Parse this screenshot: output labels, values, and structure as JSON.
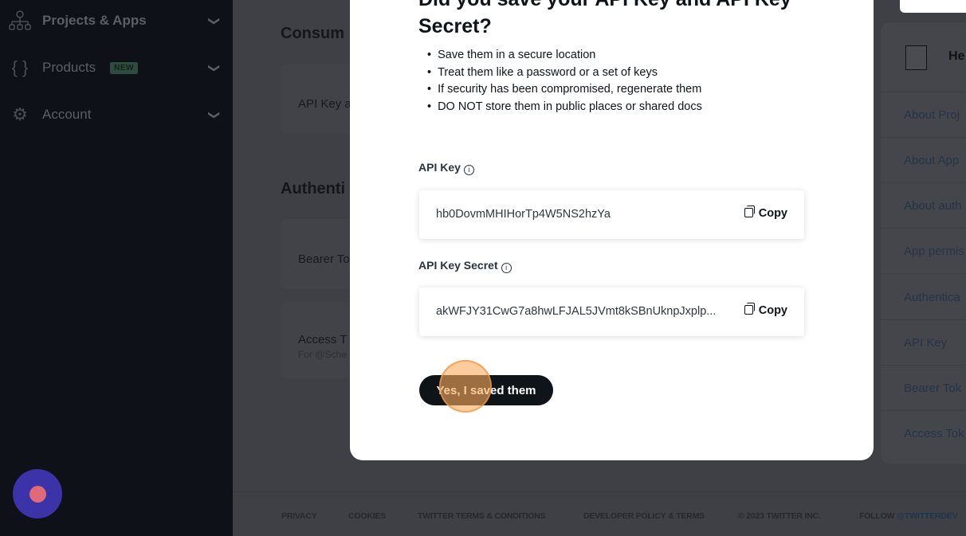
{
  "sidebar": {
    "items": [
      {
        "label": "Projects & Apps",
        "icon": "sitemap-icon"
      },
      {
        "label": "Products",
        "badge": "NEW",
        "icon": "braces-icon"
      },
      {
        "label": "Account",
        "icon": "gear-icon"
      }
    ]
  },
  "main": {
    "sections": [
      {
        "title": "Consum"
      },
      {
        "title": "Authenti"
      }
    ],
    "cards": [
      {
        "title": "API Key a"
      },
      {
        "title": "Bearer To"
      },
      {
        "title": "Access T",
        "subtitle": "For @Sche"
      }
    ]
  },
  "help": {
    "title": "He",
    "items": [
      "About Proj",
      "About App",
      "About auth",
      "App permis",
      "Authentica",
      "API Key",
      "Bearer Tok",
      "Access Tok"
    ]
  },
  "modal": {
    "title": "Did you save your API Key and API Key Secret?",
    "tips": [
      "Save them in a secure location",
      "Treat them like a password or a set of keys",
      "If security has been compromised, regenerate them",
      "DO NOT store them in public places or shared docs"
    ],
    "api_key": {
      "label": "API Key",
      "value": "hb0DovmMHIHorTp4W5NS2hzYa",
      "copy": "Copy"
    },
    "api_secret": {
      "label": "API Key Secret",
      "value": "akWFJY31CwG7a8hwLFJAL5JVmt8kSBnUknpJxplp...",
      "copy": "Copy"
    },
    "confirm": "Yes, I saved them"
  },
  "footer": {
    "links": [
      "PRIVACY",
      "COOKIES",
      "TWITTER TERMS & CONDITIONS",
      "DEVELOPER POLICY & TERMS",
      "© 2023 TWITTER INC."
    ],
    "follow": "FOLLOW ",
    "handle": "@TWITTERDEV"
  },
  "colors": {
    "overlay": "#3e4046",
    "sidebar": "#0f1118",
    "button": "#0f1419",
    "recorder": "#3c33a8"
  }
}
